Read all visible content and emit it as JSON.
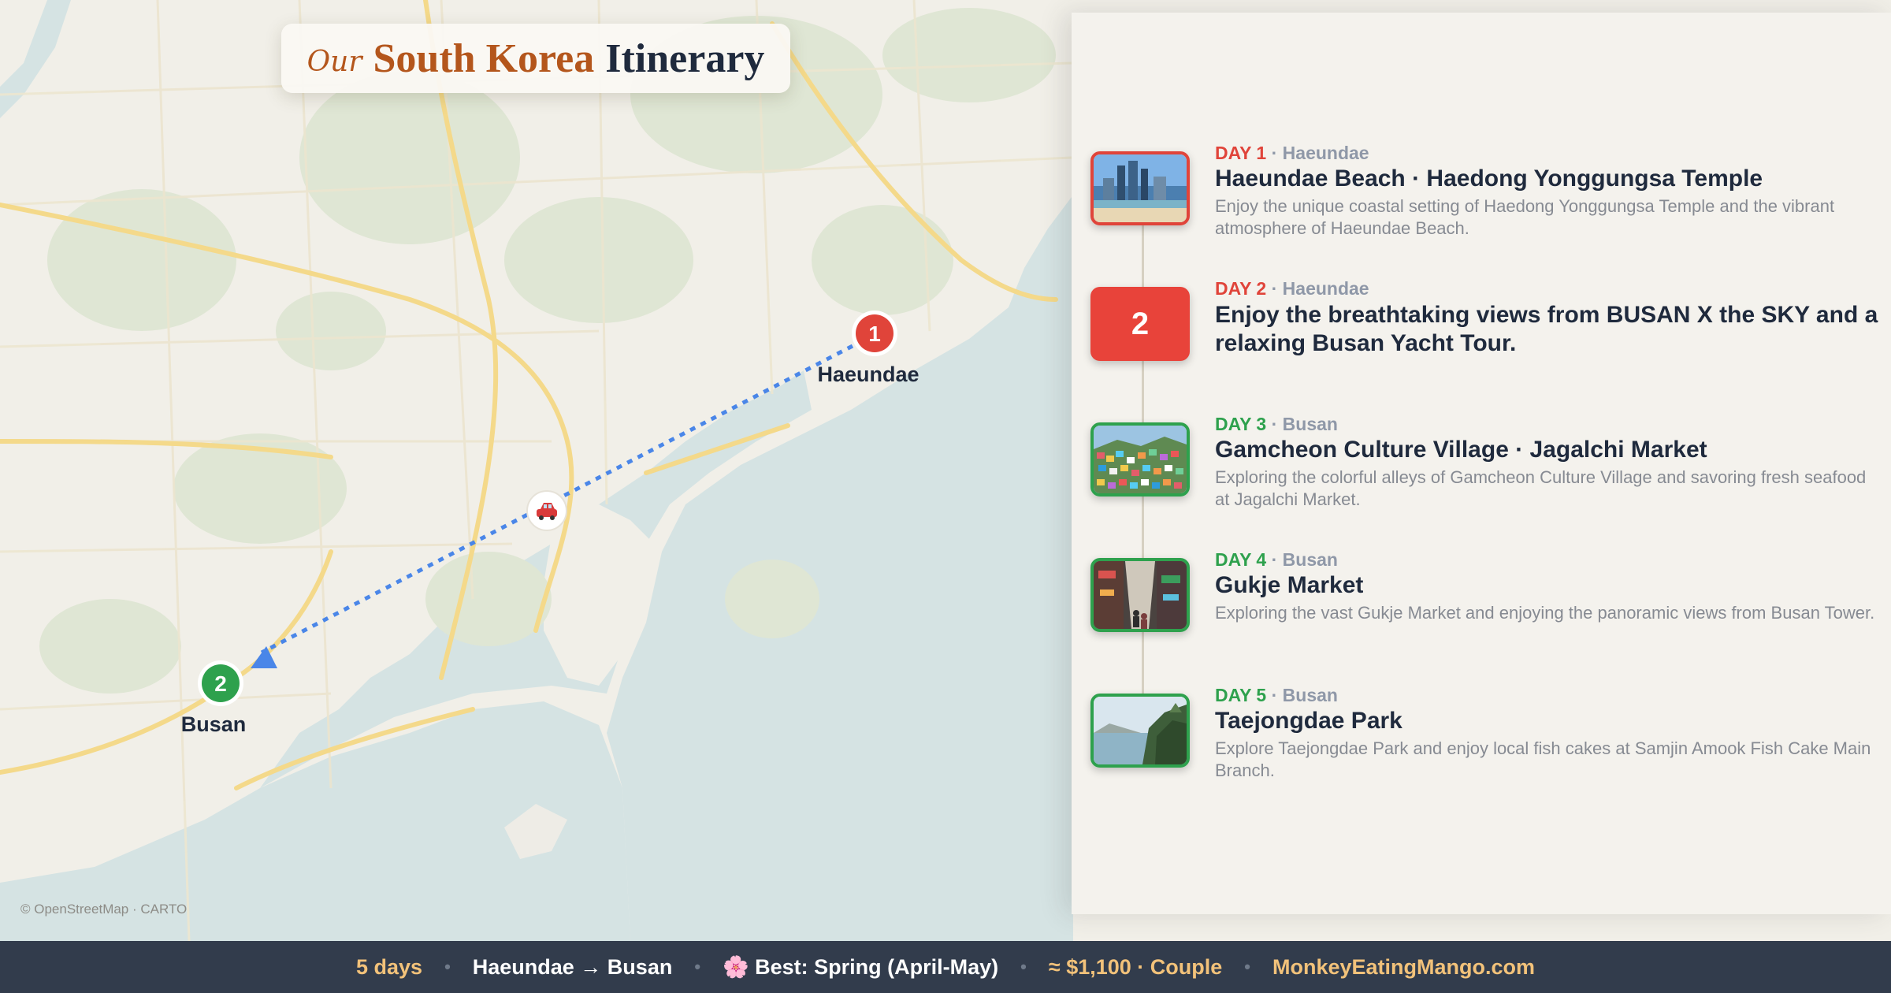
{
  "title": {
    "prefix": "Our",
    "highlight": "South Korea",
    "suffix": "Itinerary"
  },
  "map": {
    "attribution": "© OpenStreetMap · CARTO",
    "pins": [
      {
        "number": "1",
        "label": "Haeundae",
        "color": "#e0443a"
      },
      {
        "number": "2",
        "label": "Busan",
        "color": "#2ea14d"
      }
    ],
    "route_icon": "car-icon",
    "route_color": "#4a86e8"
  },
  "itinerary": [
    {
      "day": "DAY 1",
      "place": "Haeundae",
      "title": "Haeundae Beach · Haedong Yonggungsa Temple",
      "description": "Enjoy the unique coastal setting of Haedong Yonggungsa Temple and the vibrant atmosphere of Haeundae Beach.",
      "accent": "#e0443a",
      "thumbnail": "beach-skyline-photo"
    },
    {
      "day": "DAY 2",
      "place": "Haeundae",
      "badge": "2",
      "title": "Enjoy the breathtaking views from BUSAN X the SKY and a relaxing Busan Yacht Tour.",
      "description": "",
      "accent": "#e0443a"
    },
    {
      "day": "DAY 3",
      "place": "Busan",
      "title": "Gamcheon Culture Village · Jagalchi Market",
      "description": "Exploring the colorful alleys of Gamcheon Culture Village and savoring fresh seafood at Jagalchi Market.",
      "accent": "#2ea14d",
      "thumbnail": "colorful-village-photo"
    },
    {
      "day": "DAY 4",
      "place": "Busan",
      "title": "Gukje Market",
      "description": "Exploring the vast Gukje Market and enjoying the panoramic views from Busan Tower.",
      "accent": "#2ea14d",
      "thumbnail": "market-street-photo"
    },
    {
      "day": "DAY 5",
      "place": "Busan",
      "title": "Taejongdae Park",
      "description": "Explore Taejongdae Park and enjoy local fish cakes at Samjin Amook Fish Cake Main Branch.",
      "accent": "#2ea14d",
      "thumbnail": "coastal-cliff-photo"
    }
  ],
  "footer": {
    "duration": "5 days",
    "route": "Haeundae → Busan",
    "season": "🌸 Best: Spring (April-May)",
    "budget": "≈ $1,100 · Couple",
    "site": "MonkeyEatingMango.com"
  }
}
